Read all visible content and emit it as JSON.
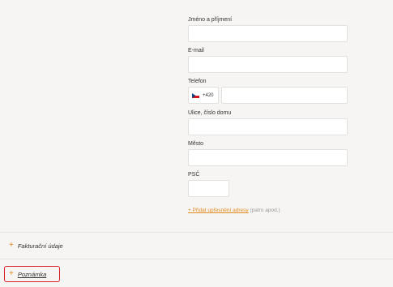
{
  "form": {
    "name_label": "Jméno a příjmení",
    "email_label": "E-mail",
    "phone_label": "Telefon",
    "phone_prefix": "+420",
    "street_label": "Ulice, číslo domu",
    "city_label": "Město",
    "zip_label": "PSČ",
    "extra_link": "+ Přidat upřesnění adresy",
    "extra_note": "(patro apod.)"
  },
  "sections": {
    "billing": "Fakturační údaje",
    "note": "Poznámka"
  },
  "icons": {
    "flag": "cz-flag-icon",
    "plus": "plus-icon"
  },
  "colors": {
    "accent": "#e08a1e",
    "highlight": "#d61f26",
    "background": "#f6f5f3"
  }
}
